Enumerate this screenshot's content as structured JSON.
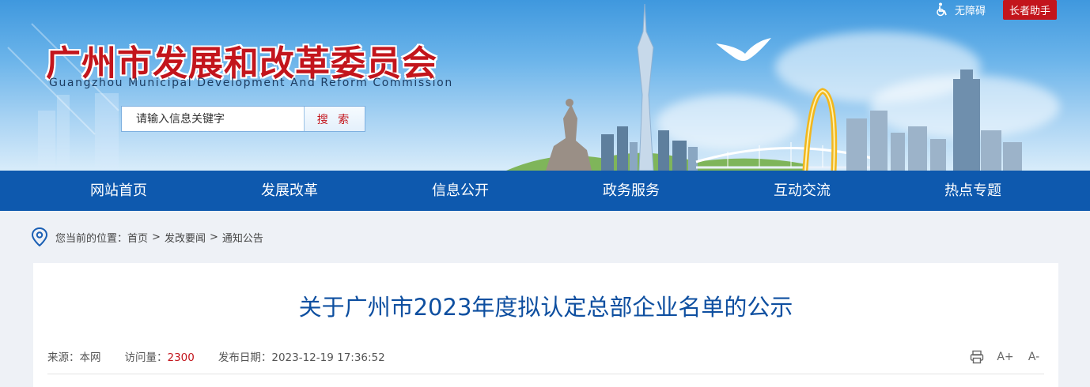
{
  "header": {
    "site_name_cn": "广州市发展和改革委员会",
    "site_name_en": "Guangzhou Municipal Development And Reform Commission",
    "search": {
      "placeholder": "请输入信息关键字",
      "button_label": "搜 索"
    },
    "accessibility_label": "无障碍",
    "elder_mode_label": "长者助手",
    "accent_color": "#c3151c"
  },
  "nav": {
    "color": "#0e59ae",
    "items": [
      {
        "label": "网站首页"
      },
      {
        "label": "发展改革"
      },
      {
        "label": "信息公开"
      },
      {
        "label": "政务服务"
      },
      {
        "label": "互动交流"
      },
      {
        "label": "热点专题"
      }
    ]
  },
  "breadcrumb": {
    "prefix": "您当前的位置：",
    "items": [
      "首页",
      "发改要闻",
      "通知公告"
    ],
    "separator": ">"
  },
  "article": {
    "title": "关于广州市2023年度拟认定总部企业名单的公示",
    "source_label": "来源：",
    "source_value": "本网",
    "views_label": "访问量：",
    "views_value": "2300",
    "date_label": "发布日期：",
    "date_value": "2023-12-19 17:36:52",
    "tools": [
      {
        "icon": "print-icon"
      },
      {
        "icon": "font-increase-icon",
        "label": "A+"
      },
      {
        "icon": "font-decrease-icon",
        "label": "A-"
      }
    ]
  }
}
